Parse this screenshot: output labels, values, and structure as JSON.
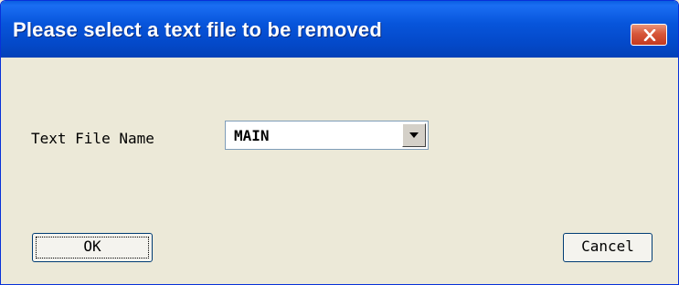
{
  "dialog": {
    "title": "Please select a text file to be removed",
    "close_icon": "close-icon",
    "field_label": "Text File Name",
    "selected_file": "MAIN",
    "dropdown_icon": "chevron-down-icon",
    "ok_label": "OK",
    "cancel_label": "Cancel"
  },
  "colors": {
    "titlebar": "#0449c9",
    "body": "#ece9d8",
    "close_button": "#d7573a"
  }
}
